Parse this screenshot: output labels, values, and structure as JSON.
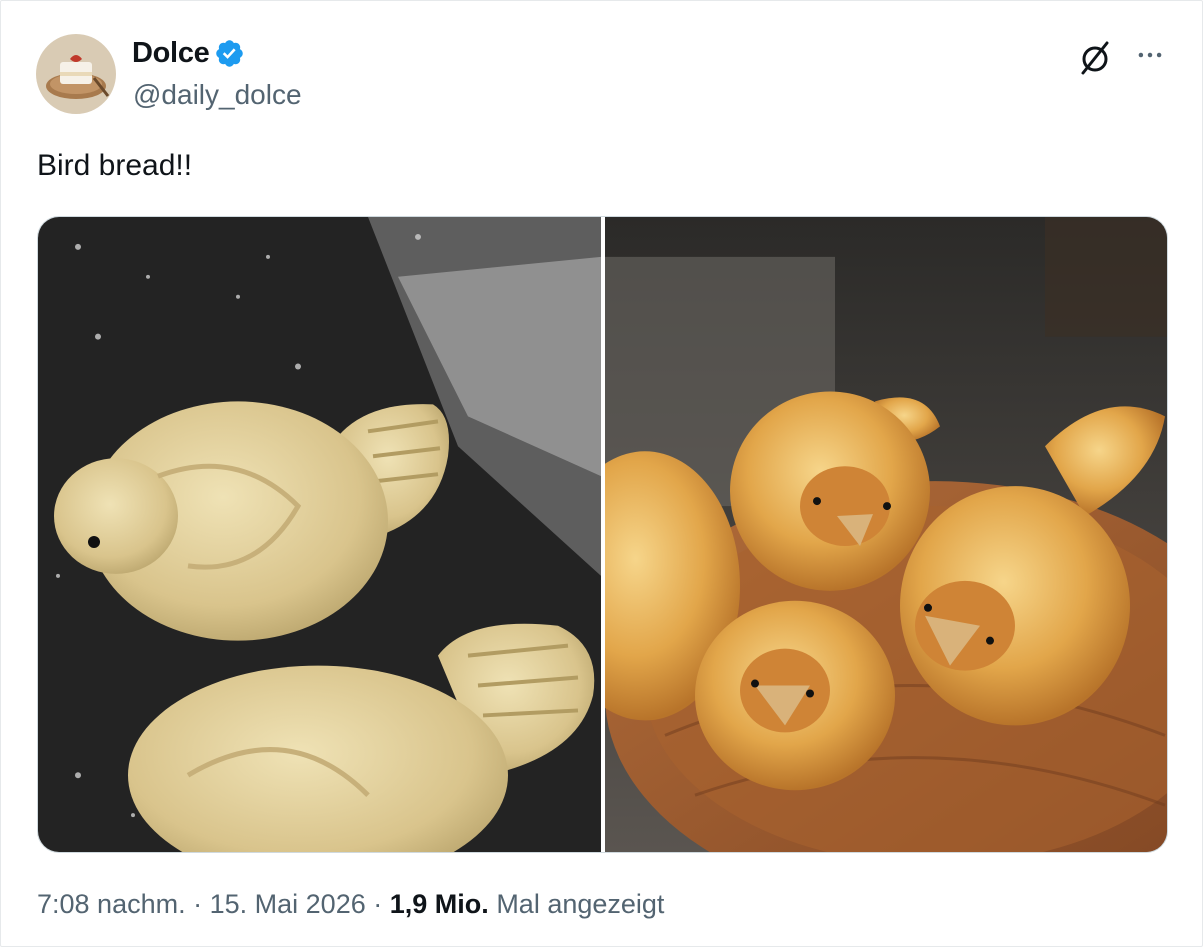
{
  "author": {
    "name": "Dolce",
    "handle": "@daily_dolce",
    "verified": true,
    "avatar_icon": "cake-slice-avatar"
  },
  "actions": {
    "grok_icon": "grok-icon",
    "more_icon": "more-options-icon"
  },
  "tweet": {
    "text": "Bird bread!!"
  },
  "media": [
    {
      "name": "photo-dough-birds",
      "icon": "image"
    },
    {
      "name": "photo-baked-bird-rolls",
      "icon": "image"
    }
  ],
  "meta": {
    "time": "7:08 nachm.",
    "separator": "·",
    "date": "15. Mai 2026",
    "views_count": "1,9 Mio.",
    "views_label": "Mal angezeigt"
  },
  "colors": {
    "verified_blue": "#1d9bf0",
    "secondary_text": "#536471",
    "primary_text": "#0f1419"
  }
}
